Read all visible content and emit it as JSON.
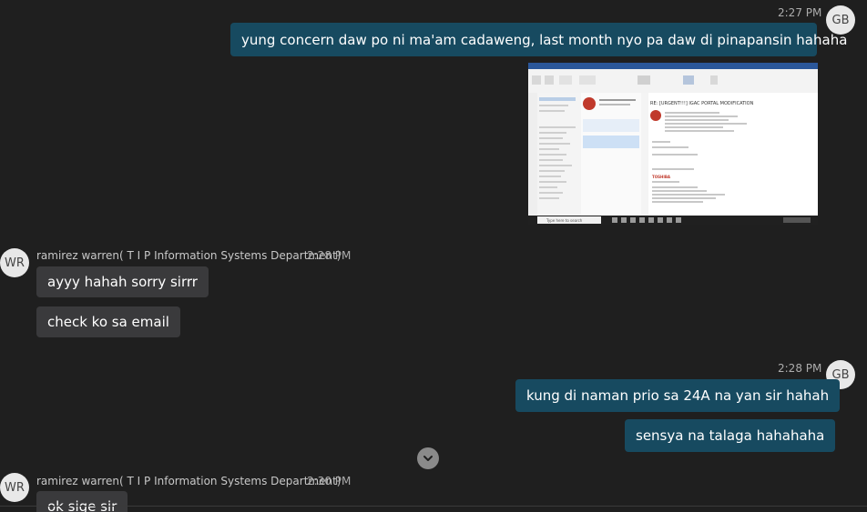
{
  "messages": [
    {
      "time": "2:27 PM",
      "avatar": "GB",
      "text": "yung concern daw po ni ma'am cadaweng, last month nyo pa daw di pinapansin hahaha"
    },
    {
      "sender": "ramirez warren( T I P  Information Systems Department)",
      "time": "2:28 PM",
      "avatar": "WR",
      "texts": [
        "ayyy hahah sorry sirrr",
        "check ko sa email"
      ]
    },
    {
      "time": "2:28 PM",
      "avatar": "GB",
      "texts": [
        "kung di naman prio sa 24A na yan sir hahah",
        "sensya na talaga hahahaha"
      ]
    },
    {
      "sender": "ramirez warren( T I P  Information Systems Department)",
      "time": "2:30 PM",
      "avatar": "WR",
      "text": "ok sige sir"
    }
  ],
  "thumbnail": {
    "subject": "RE: [URGENT!!!] IGAC PORTAL MODIFICATION",
    "brand": "TOSHIBA",
    "taskbar_search": "Type here to search",
    "accent": "#2b579a"
  },
  "colors": {
    "outgoing": "#174a60",
    "incoming": "#3a3a3c",
    "background": "#1f1f1f"
  },
  "icons": {
    "scroll": "chevron-down-icon"
  }
}
